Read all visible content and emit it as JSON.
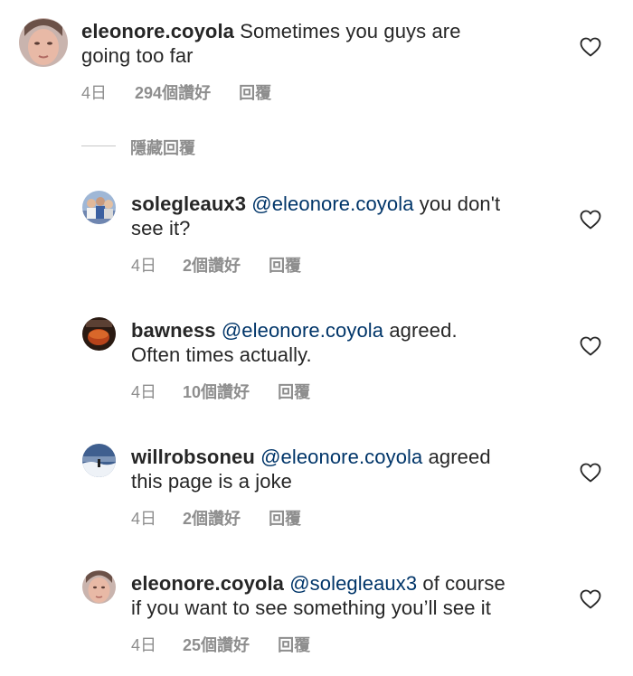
{
  "comments": [
    {
      "username": "eleonore.coyola",
      "mention": "",
      "text_line1": " Sometimes you guys are",
      "text_line2": "going too far",
      "time": "4日",
      "likes": "294個讚好",
      "reply": "回覆",
      "avatar_icon": "avatar-woman-icon"
    },
    {
      "username": "solegleaux3",
      "mention": " @eleonore.coyola",
      "text_line1": " you don't",
      "text_line2": "see it?",
      "time": "4日",
      "likes": "2個讚好",
      "reply": "回覆",
      "avatar_icon": "avatar-group-icon"
    },
    {
      "username": "bawness",
      "mention": " @eleonore.coyola",
      "text_line1": " agreed.",
      "text_line2": "Often times actually.",
      "time": "4日",
      "likes": "10個讚好",
      "reply": "回覆",
      "avatar_icon": "avatar-tea-icon"
    },
    {
      "username": "willrobsoneu",
      "mention": " @eleonore.coyola",
      "text_line1": " agreed",
      "text_line2": "this page is a joke",
      "time": "4日",
      "likes": "2個讚好",
      "reply": "回覆",
      "avatar_icon": "avatar-snow-icon"
    },
    {
      "username": "eleonore.coyola",
      "mention": " @solegleaux3",
      "text_line1": " of course",
      "text_line2": "if you want to see something you’ll see it",
      "time": "4日",
      "likes": "25個讚好",
      "reply": "回覆",
      "avatar_icon": "avatar-woman-icon"
    }
  ],
  "hide_replies": "隱藏回覆",
  "colors": {
    "username": "#262626",
    "mention": "#003569",
    "meta": "#8e8e8e",
    "heart": "#262626"
  }
}
